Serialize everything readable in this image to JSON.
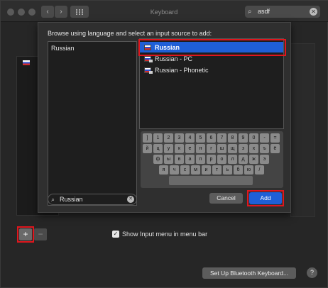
{
  "window": {
    "title": "Keyboard"
  },
  "toolbar": {
    "search_value": "asdf",
    "back_glyph": "‹",
    "forward_glyph": "›"
  },
  "sheet": {
    "prompt": "Browse using language and select an input source to add:",
    "languages": [
      "Russian"
    ],
    "sources": [
      {
        "label": "Russian",
        "selected": true
      },
      {
        "label": "Russian - PC",
        "selected": false
      },
      {
        "label": "Russian - Phonetic",
        "selected": false
      }
    ],
    "keyboard_rows": [
      [
        "]",
        "1",
        "2",
        "3",
        "4",
        "5",
        "6",
        "7",
        "8",
        "9",
        "0",
        "-",
        "="
      ],
      [
        "й",
        "ц",
        "у",
        "к",
        "е",
        "н",
        "г",
        "ш",
        "щ",
        "з",
        "х",
        "ъ",
        "ё"
      ],
      [
        "ф",
        "ы",
        "в",
        "а",
        "п",
        "р",
        "о",
        "л",
        "д",
        "ж",
        "э"
      ],
      [
        "я",
        "ч",
        "с",
        "м",
        "и",
        "т",
        "ь",
        "б",
        "ю",
        "/"
      ]
    ],
    "search_value": "Russian",
    "cancel_label": "Cancel",
    "add_label": "Add"
  },
  "footer": {
    "add_glyph": "+",
    "remove_glyph": "−",
    "show_input_menu_label": "Show Input menu in menu bar",
    "show_input_menu_checked": true,
    "bluetooth_label": "Set Up Bluetooth Keyboard...",
    "help_glyph": "?"
  },
  "colors": {
    "accent": "#1f5fd6",
    "highlight": "#e0161d"
  }
}
